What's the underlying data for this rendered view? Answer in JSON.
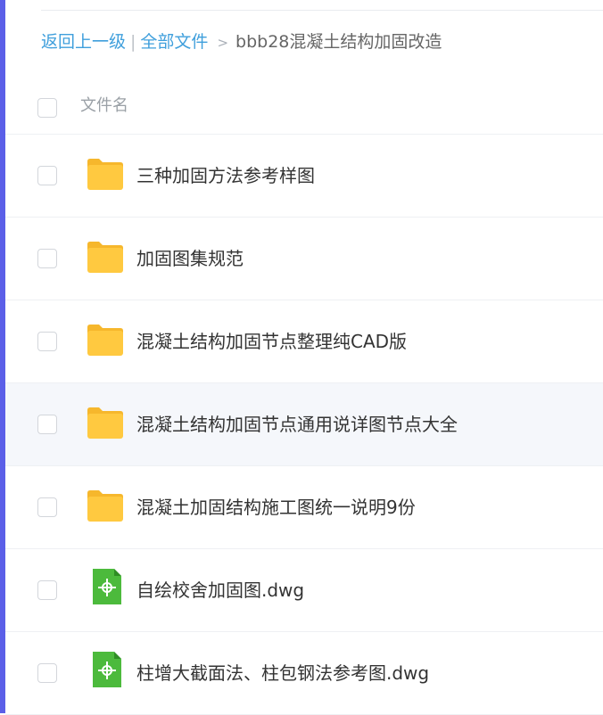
{
  "breadcrumb": {
    "back": "返回上一级",
    "separator": "|",
    "all_files": "全部文件",
    "arrow": ">",
    "current": "bbb28混凝土结构加固改造"
  },
  "header": {
    "name_label": "文件名"
  },
  "files": [
    {
      "name": "三种加固方法参考样图",
      "type": "folder",
      "icon": "folder-icon"
    },
    {
      "name": "加固图集规范",
      "type": "folder",
      "icon": "folder-icon"
    },
    {
      "name": "混凝土结构加固节点整理纯CAD版",
      "type": "folder",
      "icon": "folder-icon"
    },
    {
      "name": "混凝土结构加固节点通用说详图节点大全",
      "type": "folder",
      "icon": "folder-icon"
    },
    {
      "name": "混凝土加固结构施工图统一说明9份",
      "type": "folder",
      "icon": "folder-icon"
    },
    {
      "name": "自绘校舍加固图.dwg",
      "type": "dwg",
      "icon": "dwg-file-icon"
    },
    {
      "name": "柱增大截面法、柱包钢法参考图.dwg",
      "type": "dwg",
      "icon": "dwg-file-icon"
    }
  ],
  "colors": {
    "accent": "#5b5fe8",
    "link": "#3f9fdc",
    "folder": "#ffc940",
    "dwg": "#4cba3c"
  }
}
